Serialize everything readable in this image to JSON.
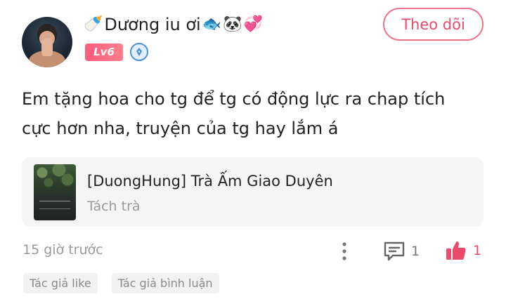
{
  "user": {
    "name": "Dương iu ơi",
    "emoji_prefix": "🍼",
    "emoji_suffix": [
      "🐟",
      "🐼",
      "💞"
    ],
    "level": "Lv6",
    "author_badge_icon": "pen-icon"
  },
  "follow_button": {
    "label": "Theo dõi"
  },
  "comment": {
    "text": "Em tặng hoa cho tg để tg có động lực ra chap tích cực hơn nha, truyện của tg hay lắm á"
  },
  "book": {
    "title": "[DuongHung] Trà Ấm Giao Duyên",
    "chapter": "Tách trà"
  },
  "meta": {
    "time": "15 giờ trước",
    "reply_count": "1",
    "like_count": "1"
  },
  "tags": [
    "Tác giả like",
    "Tác giả bình luận"
  ],
  "colors": {
    "accent": "#ec4a6a",
    "muted_text": "#9a9a9a",
    "card_bg": "#f5f5f5"
  }
}
